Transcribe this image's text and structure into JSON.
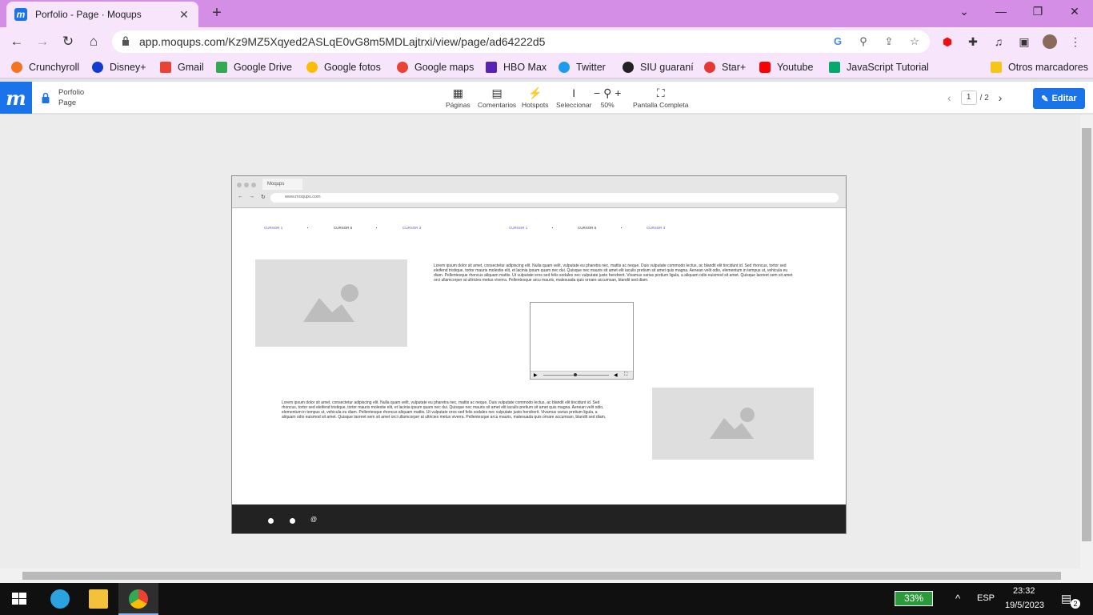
{
  "browser": {
    "tab_title": "Porfolio - Page · Moqups",
    "url": "app.moqups.com/Kz9MZ5Xqyed2ASLqE0vG8m5MDLajtrxi/view/page/ad64222d5"
  },
  "bookmarks": [
    {
      "label": "Crunchyroll",
      "color": "#f47521"
    },
    {
      "label": "Disney+",
      "color": "#113ccf"
    },
    {
      "label": "Gmail",
      "color": "#ea4335"
    },
    {
      "label": "Google Drive",
      "color": "#34a853"
    },
    {
      "label": "Google fotos",
      "color": "#fbbc04"
    },
    {
      "label": "Google maps",
      "color": "#ea4335"
    },
    {
      "label": "HBO Max",
      "color": "#5822b4"
    },
    {
      "label": "Twitter",
      "color": "#1d9bf0"
    },
    {
      "label": "SIU guaraní",
      "color": "#222222"
    },
    {
      "label": "Star+",
      "color": "#e53935"
    },
    {
      "label": "Youtube",
      "color": "#ff0000"
    },
    {
      "label": "JavaScript Tutorial",
      "color": "#04aa6d"
    },
    {
      "label": "Otros marcadores",
      "color": "#f5c518"
    }
  ],
  "moqups": {
    "project_name": "Porfolio",
    "page_name": "Page",
    "tools": [
      {
        "label": "Páginas",
        "icon": "pages-icon"
      },
      {
        "label": "Comentarios",
        "icon": "comment-icon"
      },
      {
        "label": "Hotspots",
        "icon": "lightning-icon"
      },
      {
        "label": "Seleccionar",
        "icon": "text-cursor-icon"
      },
      {
        "label": "50%",
        "icon": "zoom-icon"
      },
      {
        "label": "Pantalla Completa",
        "icon": "fullscreen-icon"
      }
    ],
    "page_current": "1",
    "page_total": "/ 2",
    "edit_label": "Editar"
  },
  "mockup": {
    "tab": "Moqups",
    "address": "www.moqups.com",
    "nav_links": [
      "CURSOR 1",
      "CURSOR 5",
      "CURSOR 3",
      "CURSOR 1",
      "CURSOR 5",
      "CURSOR 3"
    ],
    "paragraph1": "Lorem ipsum dolor sit amet, consectetur adipiscing elit. Nulla quam velit, vulputate eu pharetra nec, mattis ac neque. Duis vulputate commodo lectus, ac blandit elit tincidunt id. Sed rhoncus, tortor sed eleifend tristique, tortor mauris molestie elit, et lacinia ipsum quam nec dui. Quisque nec mauris sit amet elit iaculis pretium sit amet quis magna. Aenean velit odio, elementum in tempus ut, vehicula eu diam. Pellentesque rhoncus aliquam mattis. Ut vulputate eros sed felis sodales nec vulputate justo hendrerit. Vivamus varius pretium ligula, a aliquam odio euismod sit amet. Quisque laoreet sem sit amet orci ullamcorper at ultricies metus viverra. Pellentesque arcu mauris, malesuada quis ornare accumsan, blandit sed diam.",
    "paragraph2": "Lorem ipsum dolor sit amet, consectetur adipiscing elit. Nulla quam velit, vulputate eu pharetra nec, mattis ac neque. Duis vulputate commodo lectus, ac blandit elit tincidunt id. Sed rhoncus, tortor sed eleifend tristique, tortor mauris molestie elit, et lacinia ipsum quam nec dui. Quisque nec mauris sit amet elit iaculis pretium sit amet quis magna. Aenean velit odio, elementum in tempus ut, vehicula eu diam. Pellentesque rhoncus aliquam mattis. Ut vulputate eros sed felis sodales nec vulputate justo hendrerit. Vivamus varius pretium ligula, a aliquam odio euismod sit amet. Quisque laoreet sem sit amet orci ullamcorper at ultricies metus viverra. Pellentesque arcu mauris, malesuada quis ornare accumsan, blandit sed diam."
  },
  "taskbar": {
    "battery": "33%",
    "language": "ESP",
    "time": "23:32",
    "date": "19/5/2023",
    "notifications": "2"
  }
}
